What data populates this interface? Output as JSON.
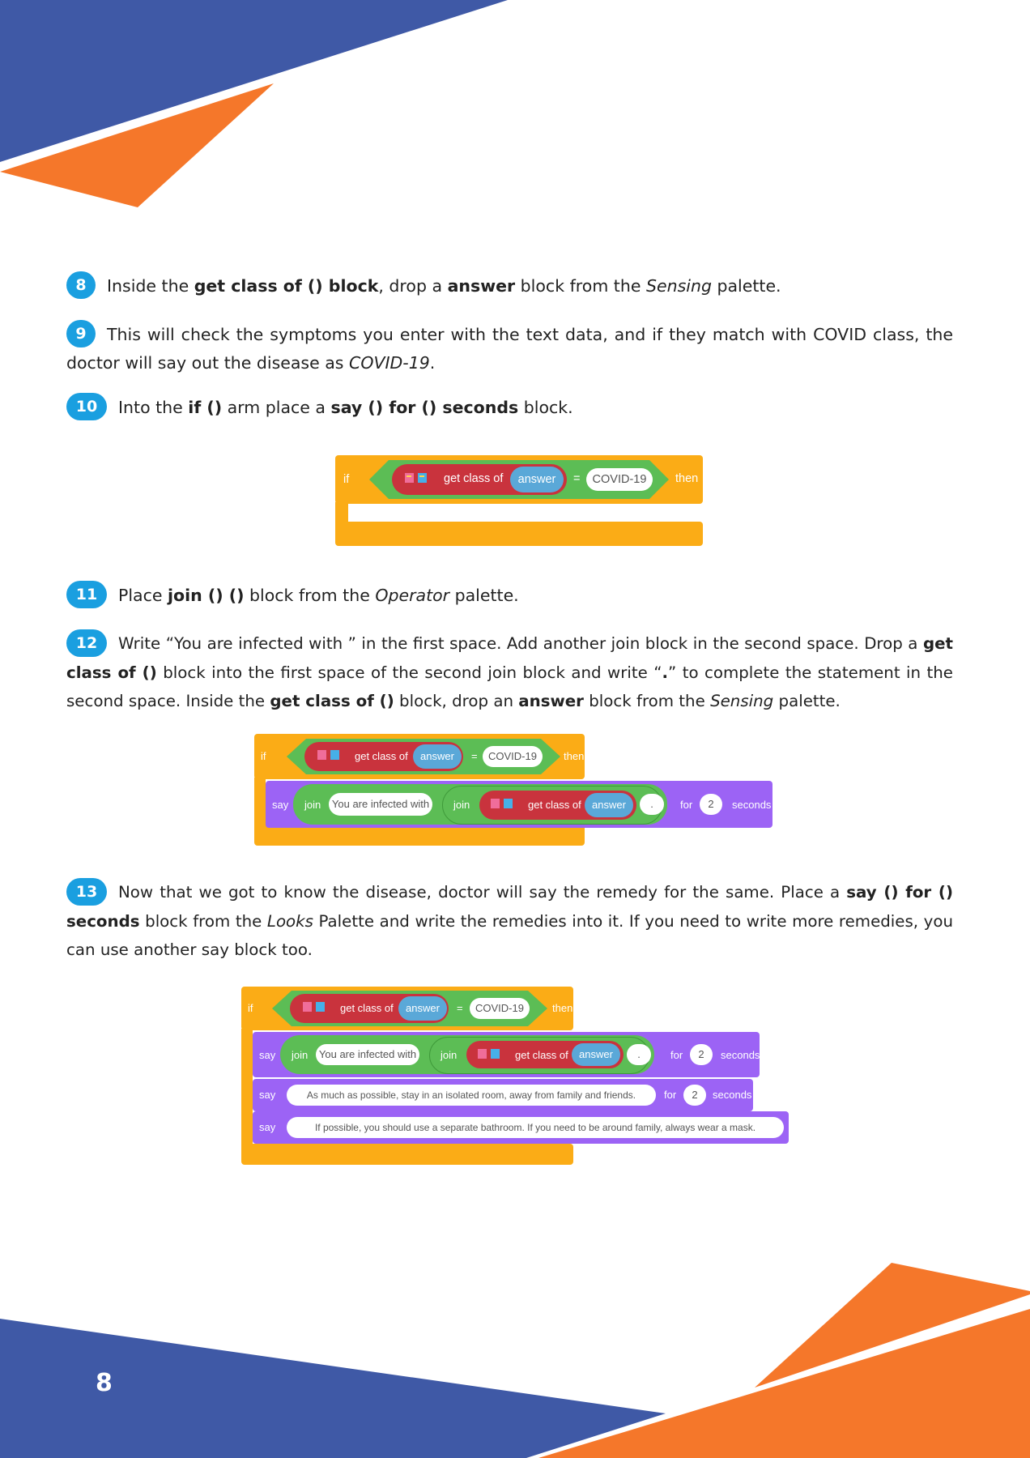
{
  "page_number": "8",
  "colors": {
    "blue": "#3f59a6",
    "orange": "#f5772a",
    "badge": "#1a9fe0"
  },
  "steps": [
    {
      "num": "8",
      "parts": [
        {
          "t": "Inside the ",
          "s": "n"
        },
        {
          "t": "get class of () block",
          "s": "b"
        },
        {
          "t": ", drop a ",
          "s": "n"
        },
        {
          "t": "answer",
          "s": "b"
        },
        {
          "t": " block from the ",
          "s": "n"
        },
        {
          "t": "Sensing",
          "s": "i"
        },
        {
          "t": " palette.",
          "s": "n"
        }
      ]
    },
    {
      "num": "9",
      "parts": [
        {
          "t": "This will check the symptoms you enter with the text data, and if they match with COVID class, the doctor will say out the disease as ",
          "s": "n"
        },
        {
          "t": "COVID-19",
          "s": "i"
        },
        {
          "t": ".",
          "s": "n"
        }
      ]
    },
    {
      "num": "10",
      "parts": [
        {
          "t": "Into the ",
          "s": "n"
        },
        {
          "t": "if ()",
          "s": "b"
        },
        {
          "t": " arm place a ",
          "s": "n"
        },
        {
          "t": "say () for () seconds",
          "s": "b"
        },
        {
          "t": " block.",
          "s": "n"
        }
      ]
    },
    {
      "num": "11",
      "parts": [
        {
          "t": "Place ",
          "s": "n"
        },
        {
          "t": "join () ()",
          "s": "b"
        },
        {
          "t": " block from the ",
          "s": "n"
        },
        {
          "t": "Operator",
          "s": "i"
        },
        {
          "t": " palette.",
          "s": "n"
        }
      ]
    },
    {
      "num": "12",
      "parts": [
        {
          "t": "Write “You are infected with ” in the first space. Add another join block in the second space. Drop a ",
          "s": "n"
        },
        {
          "t": "get class of ()",
          "s": "b"
        },
        {
          "t": " block into the first space of the second join block and write “",
          "s": "n"
        },
        {
          "t": ".",
          "s": "b"
        },
        {
          "t": "” to complete the statement in the second space. Inside the ",
          "s": "n"
        },
        {
          "t": "get class of ()",
          "s": "b"
        },
        {
          "t": " block, drop an ",
          "s": "n"
        },
        {
          "t": "answer",
          "s": "b"
        },
        {
          "t": " block from the ",
          "s": "n"
        },
        {
          "t": "Sensing",
          "s": "i"
        },
        {
          "t": " palette.",
          "s": "n"
        }
      ]
    },
    {
      "num": "13",
      "parts": [
        {
          "t": "Now that we got to know the disease, doctor will say the remedy for the same. Place a ",
          "s": "n"
        },
        {
          "t": "say () for () seconds",
          "s": "b"
        },
        {
          "t": " block from the ",
          "s": "n"
        },
        {
          "t": "Looks",
          "s": "i"
        },
        {
          "t": " Palette and write the remedies into it. If you need to write more remedies, you can use another say block too.",
          "s": "n"
        }
      ]
    }
  ],
  "blocks": {
    "if": "if",
    "then": "then",
    "get_class_of": "get class of",
    "answer": "answer",
    "equals": "=",
    "covid": "COVID-19",
    "say": "say",
    "join": "join",
    "infected_text": "You are infected with",
    "dot": ".",
    "for": "for",
    "seconds_num": "2",
    "seconds": "seconds",
    "remedy1": "As much as possible, stay in an isolated room, away from family and friends.",
    "remedy2": "If possible, you should use a separate bathroom. If you need to be around family,  always wear a mask."
  }
}
